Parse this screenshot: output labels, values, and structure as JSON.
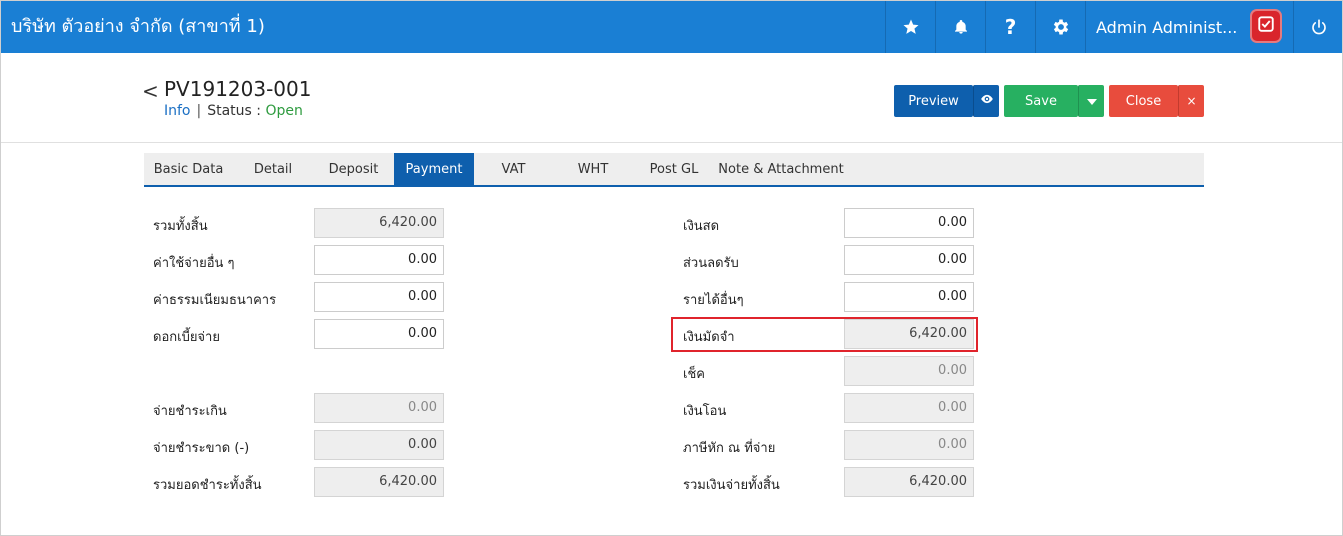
{
  "app": {
    "company": "บริษัท ตัวอย่าง จำกัด (สาขาที่ 1)",
    "user": "Admin Administ...",
    "help_label": "?"
  },
  "header": {
    "back_glyph": "<",
    "doc_no": "PV191203-001",
    "info_label": "Info",
    "separator": "|",
    "status_label": "Status",
    "status_colon": ":",
    "status_value": "Open"
  },
  "actions": {
    "preview": "Preview",
    "save": "Save",
    "close": "Close",
    "close_x": "×"
  },
  "tabs": [
    {
      "label": "Basic Data",
      "active": false
    },
    {
      "label": "Detail",
      "active": false
    },
    {
      "label": "Deposit",
      "active": false
    },
    {
      "label": "Payment",
      "active": true
    },
    {
      "label": "VAT",
      "active": false
    },
    {
      "label": "WHT",
      "active": false
    },
    {
      "label": "Post GL",
      "active": false
    },
    {
      "label": "Note & Attachment",
      "active": false
    }
  ],
  "left_fields": [
    {
      "label": "รวมทั้งสิ้น",
      "value": "6,420.00"
    },
    {
      "label": "ค่าใช้จ่ายอื่น ๆ",
      "value": "0.00"
    },
    {
      "label": "ค่าธรรมเนียมธนาคาร",
      "value": "0.00"
    },
    {
      "label": "ดอกเบี้ยจ่าย",
      "value": "0.00"
    },
    {
      "label": "จ่ายชำระเกิน",
      "value": "0.00"
    },
    {
      "label": "จ่ายชำระขาด (-)",
      "value": "0.00"
    },
    {
      "label": "รวมยอดชำระทั้งสิ้น",
      "value": "6,420.00"
    }
  ],
  "right_fields": [
    {
      "label": "เงินสด",
      "value": "0.00"
    },
    {
      "label": "ส่วนลดรับ",
      "value": "0.00"
    },
    {
      "label": "รายได้อื่นๆ",
      "value": "0.00"
    },
    {
      "label": "เงินมัดจำ",
      "value": "6,420.00"
    },
    {
      "label": "เช็ค",
      "value": "0.00"
    },
    {
      "label": "เงินโอน",
      "value": "0.00"
    },
    {
      "label": "ภาษีหัก ณ ที่จ่าย",
      "value": "0.00"
    },
    {
      "label": "รวมเงินจ่ายทั้งสิ้น",
      "value": "6,420.00"
    }
  ],
  "colors": {
    "topbar": "#1a7fd4",
    "primary": "#0e5fad",
    "save": "#27b061",
    "close": "#e84c3d",
    "status_open": "#2e9b3f",
    "highlight": "#e0242c"
  },
  "icons": [
    "star-icon",
    "bell-icon",
    "gear-icon",
    "power-icon",
    "eye-icon",
    "caret-down-icon",
    "chevron-left-icon"
  ]
}
